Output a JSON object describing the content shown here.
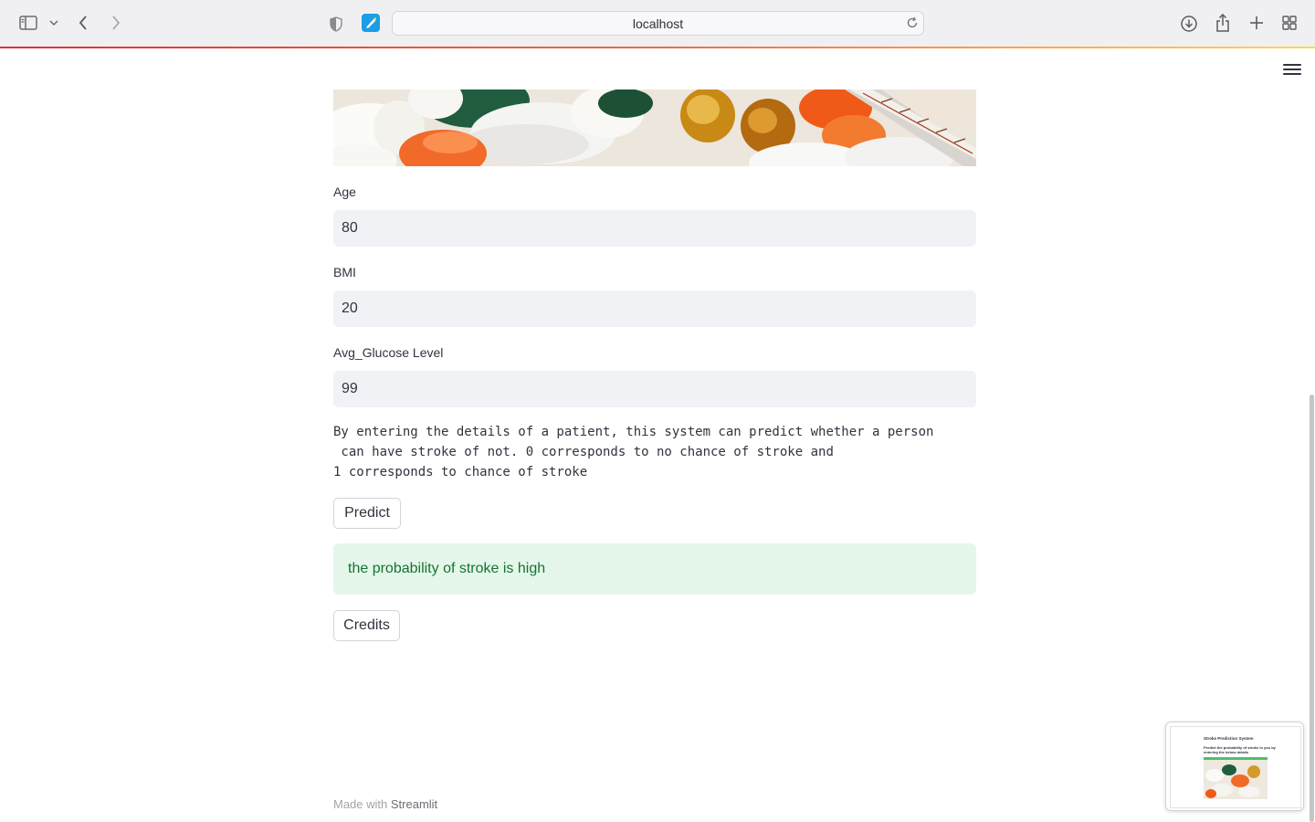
{
  "browser": {
    "url": "localhost"
  },
  "form": {
    "age_label": "Age",
    "age_value": "80",
    "bmi_label": "BMI",
    "bmi_value": "20",
    "glucose_label": "Avg_Glucose Level",
    "glucose_value": "99"
  },
  "description": "By entering the details of a patient, this system can predict whether a person\n can have stroke of not. 0 corresponds to no chance of stroke and\n1 corresponds to chance of stroke",
  "predict_button": "Predict",
  "result": "the probability of stroke is high",
  "credits_button": "Credits",
  "footer": {
    "prefix": "Made with ",
    "brand": "Streamlit"
  },
  "thumbnail": {
    "title": "Stroke Prediction System",
    "subtitle": "Predict the probability of stroke in you by entering the below details"
  },
  "icons": [
    "sidebar-toggle-icon",
    "chevron-down-icon",
    "back-arrow-icon",
    "forward-arrow-icon",
    "shield-icon",
    "streamlit-tab-icon",
    "reload-icon",
    "download-icon",
    "share-icon",
    "new-tab-icon",
    "tab-overview-icon",
    "hamburger-menu-icon"
  ],
  "colors": {
    "success_bg": "#e4f7ea",
    "success_text": "#177233",
    "input_bg": "#f0f2f6"
  }
}
